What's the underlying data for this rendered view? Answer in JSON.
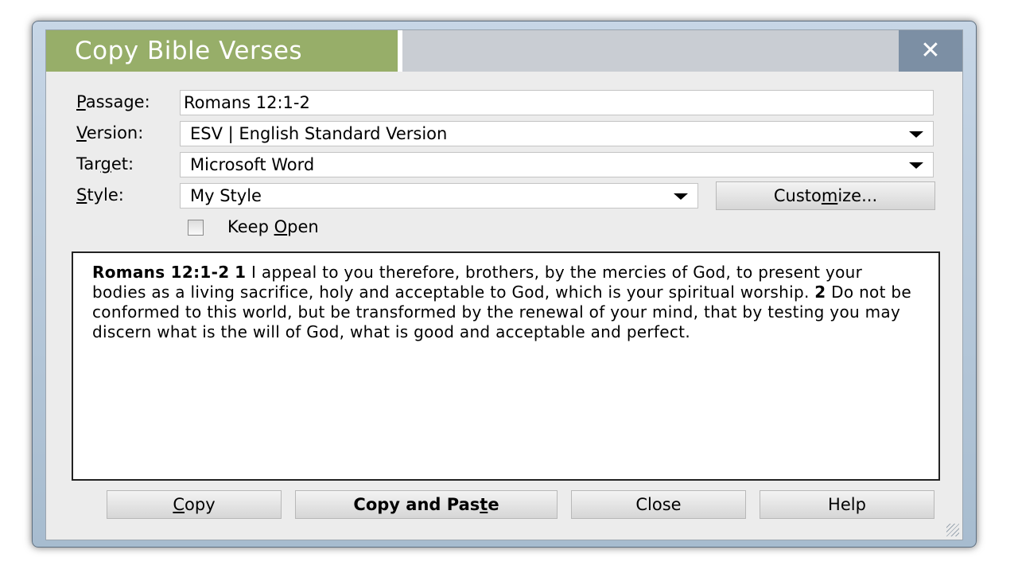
{
  "dialog": {
    "title": "Copy Bible Verses",
    "close_glyph": "✕"
  },
  "form": {
    "passage": {
      "label_pre": "",
      "label_u": "P",
      "label_post": "assage:",
      "value": "Romans 12:1-2"
    },
    "version": {
      "label_pre": "",
      "label_u": "V",
      "label_post": "ersion:",
      "value": "ESV | English Standard Version"
    },
    "target": {
      "label_pre": "Tar",
      "label_u": "g",
      "label_post": "et:",
      "value": "Microsoft Word"
    },
    "style": {
      "label_pre": "",
      "label_u": "S",
      "label_post": "tyle:",
      "value": "My Style"
    },
    "customize": {
      "pre": "Custo",
      "u": "m",
      "post": "ize..."
    },
    "keep_open": {
      "pre": "Keep ",
      "u": "O",
      "post": "pen",
      "checked": false
    }
  },
  "preview": {
    "ref": "Romans 12:1-2",
    "v1_num": "1",
    "v1_text": " I appeal to you therefore, brothers, by the mercies of God, to present your bodies as a living sacrifice, holy and acceptable to God, which is your spiritual worship. ",
    "v2_num": "2",
    "v2_text": " Do not be conformed to this world, but be transformed by the renewal of your mind, that by testing you may discern what is the will of God, what is good and acceptable and perfect."
  },
  "buttons": {
    "copy": {
      "pre": "",
      "u": "C",
      "post": "opy"
    },
    "copy_paste": {
      "pre": "Copy and Pas",
      "u": "t",
      "post": "e"
    },
    "close": "Close",
    "help": "Help"
  },
  "colors": {
    "title_tab": "#97ae69",
    "title_bar": "#c9cdd3",
    "close_button": "#7c8fa4"
  }
}
